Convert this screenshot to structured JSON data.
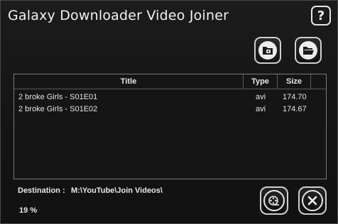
{
  "window": {
    "title": "Galaxy Downloader Video Joiner"
  },
  "toolbar": {
    "help_label": "?",
    "add_file_icon": "add-video-file-icon",
    "open_folder_icon": "open-folder-icon"
  },
  "list": {
    "columns": [
      "Title",
      "Type",
      "Size"
    ],
    "rows": [
      {
        "title": "2 broke Girls - S01E01",
        "type": "avi",
        "size": "174.70"
      },
      {
        "title": "2 broke Girls - S01E02",
        "type": "avi",
        "size": "174.67"
      }
    ]
  },
  "footer": {
    "destination_label": "Destination :",
    "destination_path": "M:\\YouTube\\Join Videos\\",
    "progress_text": "19 %",
    "progress_value": 0.19,
    "join_icon": "film-reel-icon",
    "close_icon": "close-icon"
  },
  "colors": {
    "background": "#161616",
    "border": "#cfcfcf",
    "text": "#e8e8e8"
  }
}
